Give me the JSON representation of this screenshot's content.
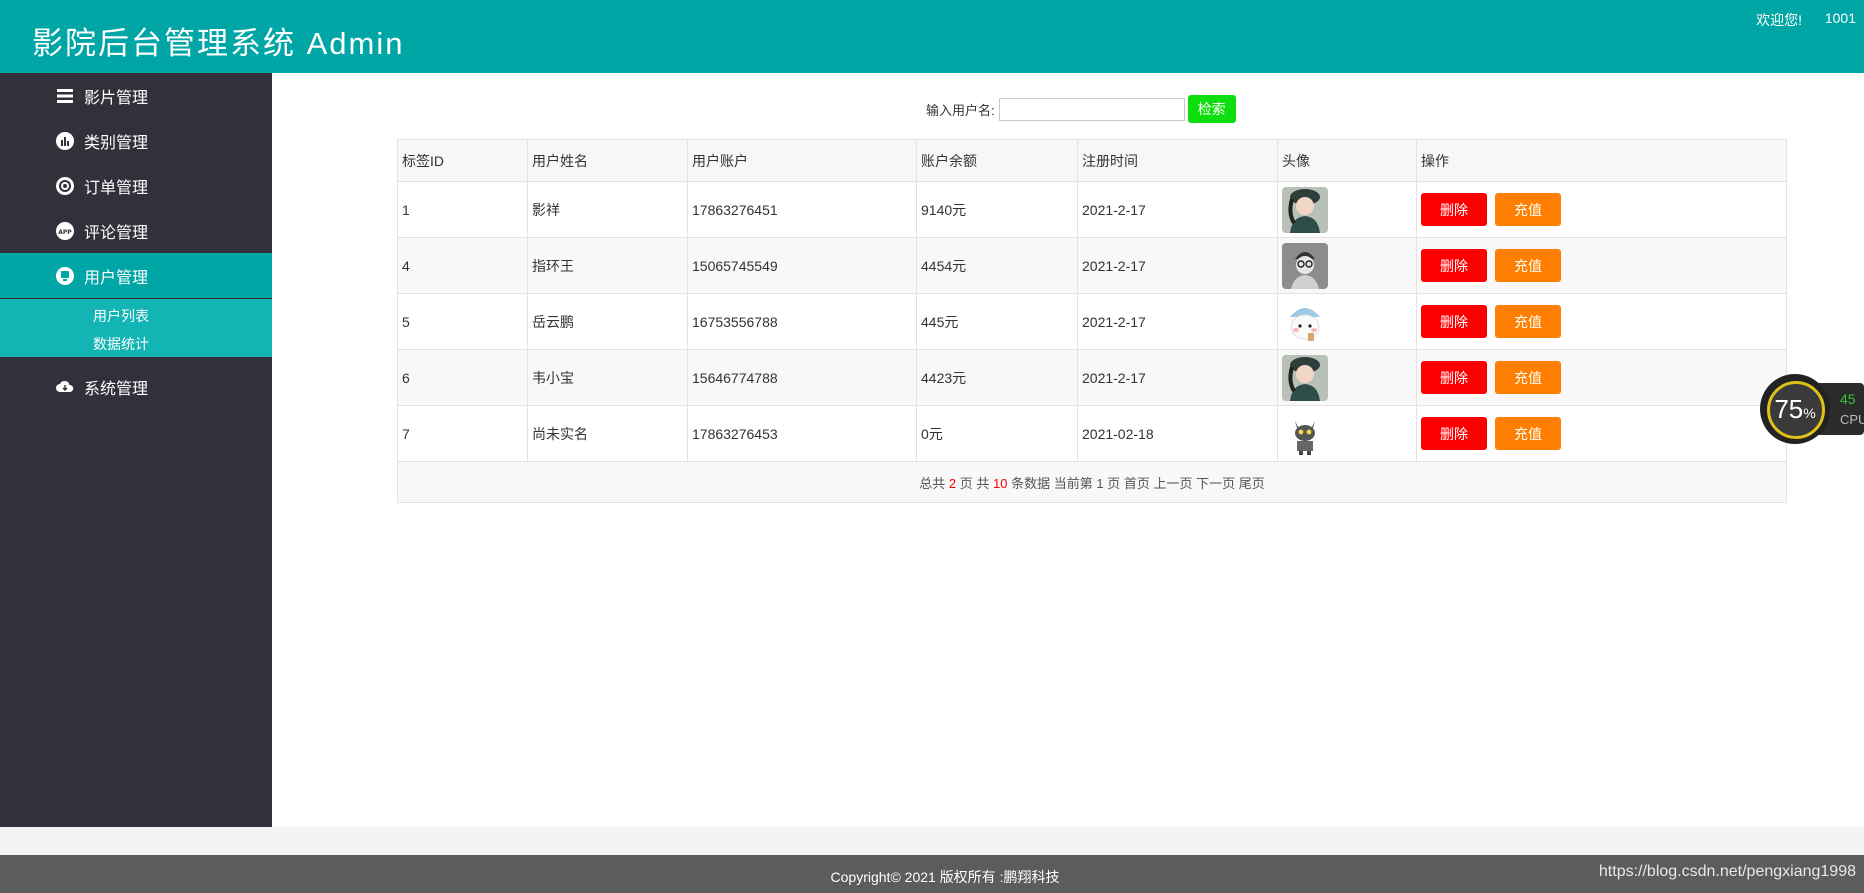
{
  "header": {
    "title": "影院后台管理系统 Admin",
    "welcome": "欢迎您!",
    "user_id": "1001"
  },
  "sidebar": {
    "items": [
      {
        "label": "影片管理",
        "icon": "layers-icon"
      },
      {
        "label": "类别管理",
        "icon": "bar-chart-icon"
      },
      {
        "label": "订单管理",
        "icon": "target-icon"
      },
      {
        "label": "评论管理",
        "icon": "app-icon"
      },
      {
        "label": "用户管理",
        "icon": "user-icon",
        "active": true
      },
      {
        "label": "系统管理",
        "icon": "cloud-icon"
      }
    ],
    "submenu": [
      "用户列表",
      "数据统计"
    ]
  },
  "search": {
    "label": "输入用户名:",
    "value": "",
    "button": "检索"
  },
  "table": {
    "headers": [
      "标签ID",
      "用户姓名",
      "用户账户",
      "账户余额",
      "注册时间",
      "头像",
      "操作"
    ],
    "rows": [
      {
        "id": "1",
        "name": "影祥",
        "account": "17863276451",
        "balance": "9140元",
        "date": "2021-2-17"
      },
      {
        "id": "4",
        "name": "指环王",
        "account": "15065745549",
        "balance": "4454元",
        "date": "2021-2-17"
      },
      {
        "id": "5",
        "name": "岳云鹏",
        "account": "16753556788",
        "balance": "445元",
        "date": "2021-2-17"
      },
      {
        "id": "6",
        "name": "韦小宝",
        "account": "15646774788",
        "balance": "4423元",
        "date": "2021-2-17"
      },
      {
        "id": "7",
        "name": "尚未实名",
        "account": "17863276453",
        "balance": "0元",
        "date": "2021-02-18"
      }
    ],
    "actions": {
      "delete": "删除",
      "charge": "充值"
    }
  },
  "pagination": {
    "total_prefix": "总共",
    "total_pages": "2",
    "pages_mid": "页 共",
    "total_records": "10",
    "records_suffix": "条数据 当前第",
    "current_page": "1",
    "page_suffix": "页",
    "first": "首页",
    "prev": "上一页",
    "next": "下一页",
    "last": "尾页"
  },
  "footer": {
    "copyright": "Copyright© 2021 版权所有 :鹏翔科技",
    "watermark": "https://blog.csdn.net/pengxiang1998"
  },
  "cpu_widget": {
    "percent": "75",
    "unit": "%",
    "secondary": "45",
    "label": "CPU"
  },
  "colors": {
    "teal": "#00a5a6",
    "sidebar": "#31313b",
    "submenu": "#12b5b3",
    "delete": "#ff0000",
    "charge": "#ff7f00",
    "search": "#0dde0d"
  }
}
